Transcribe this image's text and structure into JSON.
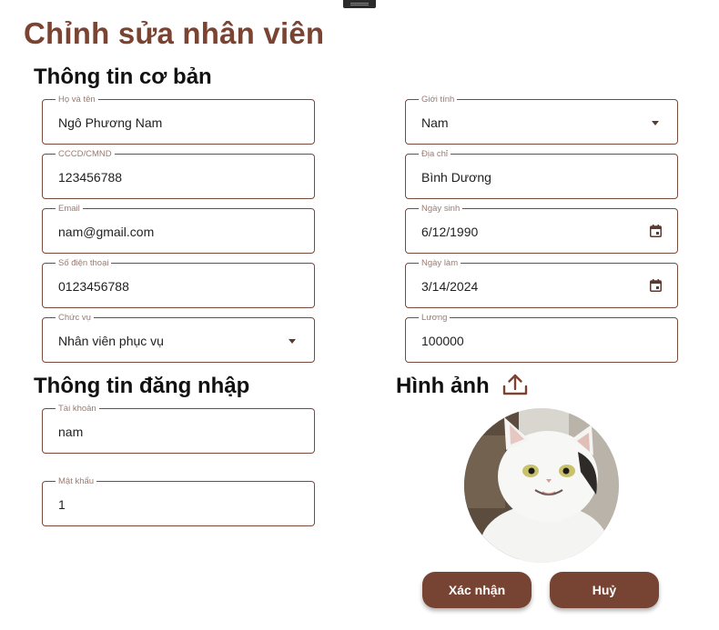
{
  "page_title": "Chỉnh sửa nhân viên",
  "sections": {
    "basic": "Thông tin cơ bản",
    "login": "Thông tin đăng nhập",
    "image": "Hình ảnh"
  },
  "fields": {
    "full_name": {
      "label": "Họ và tên",
      "value": "Ngô Phương Nam"
    },
    "id_card": {
      "label": "CCCD/CMND",
      "value": "123456788"
    },
    "email": {
      "label": "Email",
      "value": "nam@gmail.com"
    },
    "phone": {
      "label": "Số điện thoại",
      "value": "0123456788"
    },
    "position": {
      "label": "Chức vụ",
      "value": "Nhân viên phục vụ"
    },
    "gender": {
      "label": "Giới tính",
      "value": "Nam"
    },
    "address": {
      "label": "Địa chỉ",
      "value": "Bình Dương"
    },
    "birth_date": {
      "label": "Ngày sinh",
      "value": "6/12/1990"
    },
    "start_date": {
      "label": "Ngày làm",
      "value": "3/14/2024"
    },
    "salary": {
      "label": "Lương",
      "value": "100000"
    },
    "username": {
      "label": "Tài khoản",
      "value": "nam"
    },
    "password": {
      "label": "Mật khẩu",
      "value": "1"
    }
  },
  "buttons": {
    "confirm": "Xác nhận",
    "cancel": "Huỷ"
  },
  "icons": {
    "upload": "upload-icon",
    "calendar": "calendar-icon",
    "dropdown": "chevron-down-icon"
  },
  "colors": {
    "accent": "#774433",
    "title": "#7a4332",
    "field_border": "#7a4a3a",
    "label": "#9a7b72"
  }
}
